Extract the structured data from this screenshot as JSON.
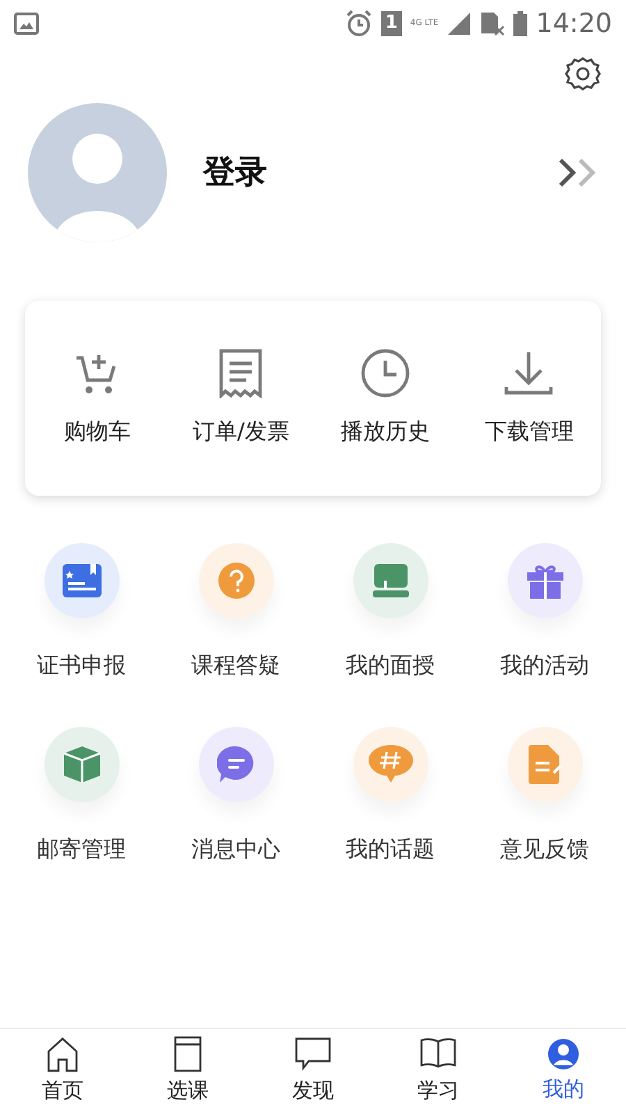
{
  "status_bar": {
    "sim": "1",
    "network": "4G LTE",
    "time": "14:20"
  },
  "profile": {
    "login": "登录"
  },
  "quick_actions": [
    {
      "label": "购物车"
    },
    {
      "label": "订单/发票"
    },
    {
      "label": "播放历史"
    },
    {
      "label": "下载管理"
    }
  ],
  "services": [
    {
      "label": "证书申报",
      "color": "#3d6fe3"
    },
    {
      "label": "课程答疑",
      "color": "#f09a3e"
    },
    {
      "label": "我的面授",
      "color": "#4a9468"
    },
    {
      "label": "我的活动",
      "color": "#7c6ee6"
    },
    {
      "label": "邮寄管理",
      "color": "#4a9468"
    },
    {
      "label": "消息中心",
      "color": "#7c6ee6"
    },
    {
      "label": "我的话题",
      "color": "#f09a3e"
    },
    {
      "label": "意见反馈",
      "color": "#f09a3e"
    }
  ],
  "tab_bar": [
    {
      "label": "首页",
      "selected": false
    },
    {
      "label": "选课",
      "selected": false
    },
    {
      "label": "发现",
      "selected": false
    },
    {
      "label": "学习",
      "selected": false
    },
    {
      "label": "我的",
      "selected": true
    }
  ]
}
